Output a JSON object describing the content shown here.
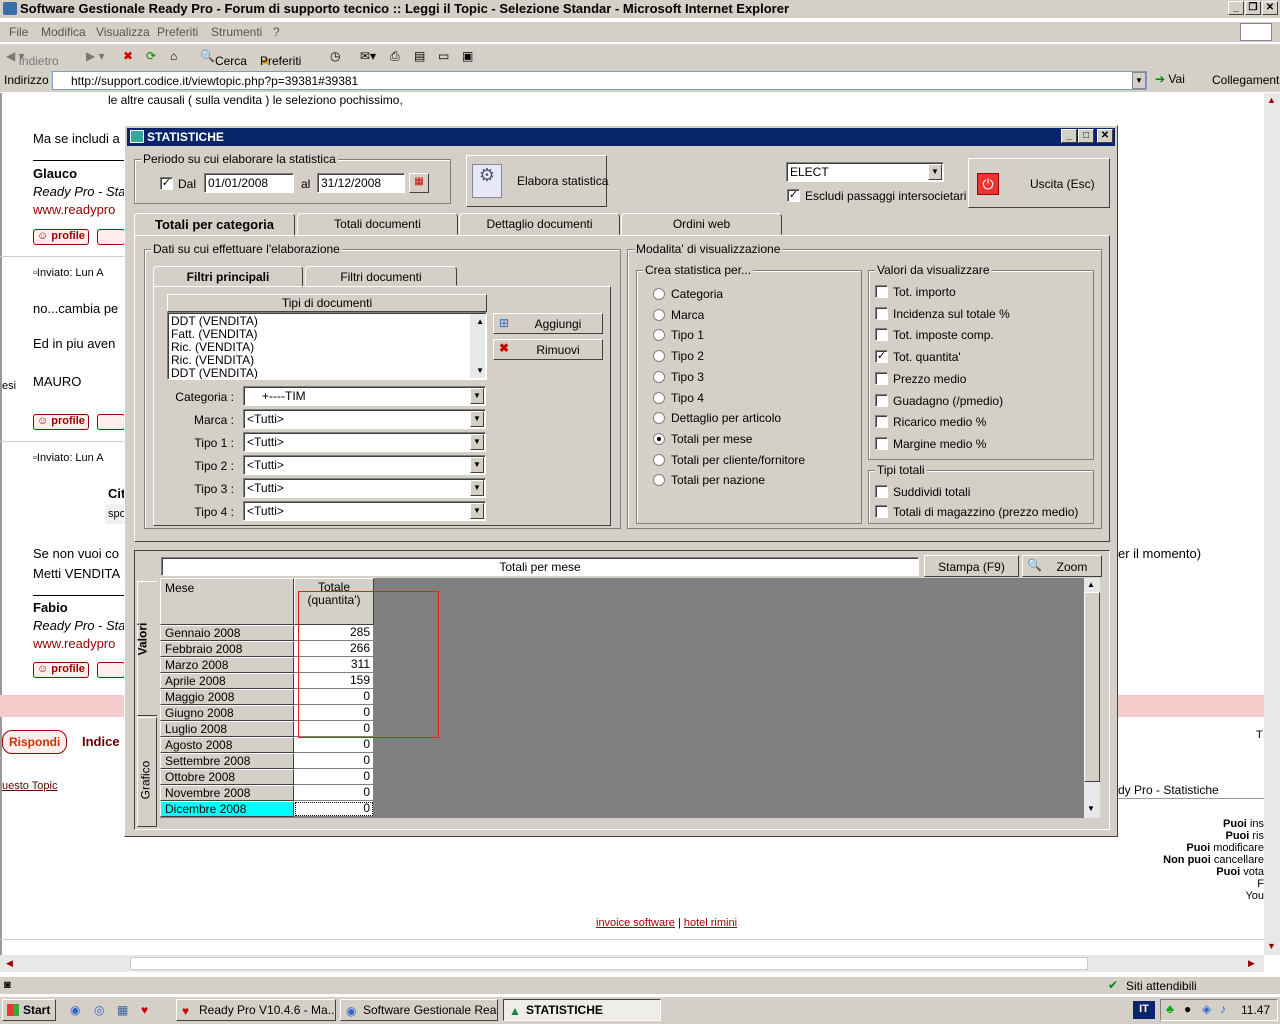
{
  "browser": {
    "title": "Software Gestionale Ready Pro - Forum di supporto tecnico :: Leggi il Topic - Selezione Standar - Microsoft Internet Explorer",
    "menu": [
      "File",
      "Modifica",
      "Visualizza",
      "Preferiti",
      "Strumenti",
      "?"
    ],
    "toolbar": {
      "back": "Indietro",
      "search": "Cerca",
      "favorites": "Preferiti"
    },
    "address_label": "Indirizzo",
    "url": "http://support.codice.it/viewtopic.php?p=39381#39381",
    "go": "Vai",
    "links": "Collegamenti",
    "status": "Siti attendibili"
  },
  "forum": {
    "line_top": "le altre causali ( sulla vendita ) le seleziono pochissimo,",
    "ma_se": "Ma se includi a",
    "author1": "Glauco",
    "author1_sub": "Ready Pro - Sta",
    "author1_url": "www.readypro",
    "profile": "profile",
    "posted1": "Inviato: Lun A",
    "msg1a": "no...cambia pe",
    "msg1b": "Ed in piu aven",
    "msg1c": "MAURO",
    "side": "esi",
    "posted2": "Inviato: Lun A",
    "cit": "Cit",
    "spo": "spo",
    "msg2a": "Se non vuoi co",
    "msg2a_end": "er il momento)",
    "msg2b": "Metti VENDITA",
    "author2": "Fabio",
    "author2_sub": "Ready Pro - Sta",
    "author2_url": "www.readypro",
    "reply": "Rispondi",
    "index": "Indice",
    "topic_link": "uesto Topic",
    "breadcrumb_end": "dy Pro - Statistiche",
    "t_right": "T",
    "perms": [
      {
        "b": "Puoi",
        "t": " ins"
      },
      {
        "b": "Puoi",
        "t": " ris"
      },
      {
        "b": "Puoi",
        "t": " modificare"
      },
      {
        "b": "Non puoi",
        "t": " cancellare"
      },
      {
        "b": "Puoi",
        "t": " vota"
      }
    ],
    "perm_f": "F",
    "perm_you": "You",
    "footer_link1": "invoice software",
    "footer_sep": "|",
    "footer_link2": "hotel rimini"
  },
  "taskbar": {
    "start": "Start",
    "items": [
      "Ready Pro V10.4.6 - Ma...",
      "Software Gestionale Rea...",
      "STATISTICHE"
    ],
    "lang": "IT",
    "time": "11.47"
  },
  "dialog": {
    "title": "STATISTICHE",
    "period_label": "Periodo su cui elaborare la statistica",
    "dal": "Dal",
    "date_from": "01/01/2008",
    "al": "al",
    "date_to": "31/12/2008",
    "elabora": "Elabora statistica",
    "company": "ELECT",
    "escludi": "Escludi passaggi intersocietari",
    "uscita": "Uscita (Esc)",
    "tabs": [
      "Totali per categoria",
      "Totali documenti",
      "Dettaglio documenti",
      "Ordini web"
    ],
    "dati_label": "Dati su cui effettuare l'elaborazione",
    "subtabs": [
      "Filtri principali",
      "Filtri documenti"
    ],
    "tipi_header": "Tipi di documenti",
    "tipi": [
      "DDT (VENDITA)",
      "Fatt. (VENDITA)",
      "Ric. (VENDITA)",
      "Ric. (VENDITA)",
      "DDT (VENDITA)"
    ],
    "aggiungi": "Aggiungi",
    "rimuovi": "Rimuovi",
    "filters": [
      {
        "label": "Categoria :",
        "value": "+----TIM"
      },
      {
        "label": "Marca :",
        "value": "<Tutti>"
      },
      {
        "label": "Tipo 1 :",
        "value": "<Tutti>"
      },
      {
        "label": "Tipo 2 :",
        "value": "<Tutti>"
      },
      {
        "label": "Tipo 3 :",
        "value": "<Tutti>"
      },
      {
        "label": "Tipo 4 :",
        "value": "<Tutti>"
      }
    ],
    "modalita_label": "Modalita' di visualizzazione",
    "crea_label": "Crea statistica per...",
    "crea": [
      "Categoria",
      "Marca",
      "Tipo 1",
      "Tipo 2",
      "Tipo 3",
      "Tipo 4",
      "Dettaglio per articolo",
      "Totali per mese",
      "Totali per cliente/fornitore",
      "Totali per nazione"
    ],
    "crea_selected": 7,
    "valori_label": "Valori da visualizzare",
    "valori": [
      {
        "label": "Tot. importo",
        "checked": false
      },
      {
        "label": "Incidenza sul totale %",
        "checked": false
      },
      {
        "label": "Tot. imposte comp.",
        "checked": false
      },
      {
        "label": "Tot. quantita'",
        "checked": true
      },
      {
        "label": "Prezzo medio",
        "checked": false
      },
      {
        "label": "Guadagno (/pmedio)",
        "checked": false
      },
      {
        "label": "Ricarico medio %",
        "checked": false
      },
      {
        "label": "Margine medio %",
        "checked": false
      }
    ],
    "tipi_totali_label": "Tipi totali",
    "tipi_totali": [
      {
        "label": "Suddividi totali",
        "checked": false
      },
      {
        "label": "Totali di magazzino (prezzo medio)",
        "checked": false
      }
    ],
    "results_title": "Totali per mese",
    "stampa": "Stampa (F9)",
    "zoom": "Zoom",
    "side_tabs": [
      "Valori",
      "Grafico"
    ],
    "grid_headers": {
      "mese": "Mese",
      "totale": "Totale",
      "totale_sub": "(quantita')"
    },
    "rows": [
      {
        "mese": "Gennaio 2008",
        "val": "285"
      },
      {
        "mese": "Febbraio 2008",
        "val": "266"
      },
      {
        "mese": "Marzo 2008",
        "val": "311"
      },
      {
        "mese": "Aprile 2008",
        "val": "159"
      },
      {
        "mese": "Maggio 2008",
        "val": "0"
      },
      {
        "mese": "Giugno 2008",
        "val": "0"
      },
      {
        "mese": "Luglio 2008",
        "val": "0"
      },
      {
        "mese": "Agosto 2008",
        "val": "0"
      },
      {
        "mese": "Settembre 2008",
        "val": "0"
      },
      {
        "mese": "Ottobre 2008",
        "val": "0"
      },
      {
        "mese": "Novembre 2008",
        "val": "0"
      },
      {
        "mese": "Dicembre 2008",
        "val": "0"
      }
    ]
  }
}
